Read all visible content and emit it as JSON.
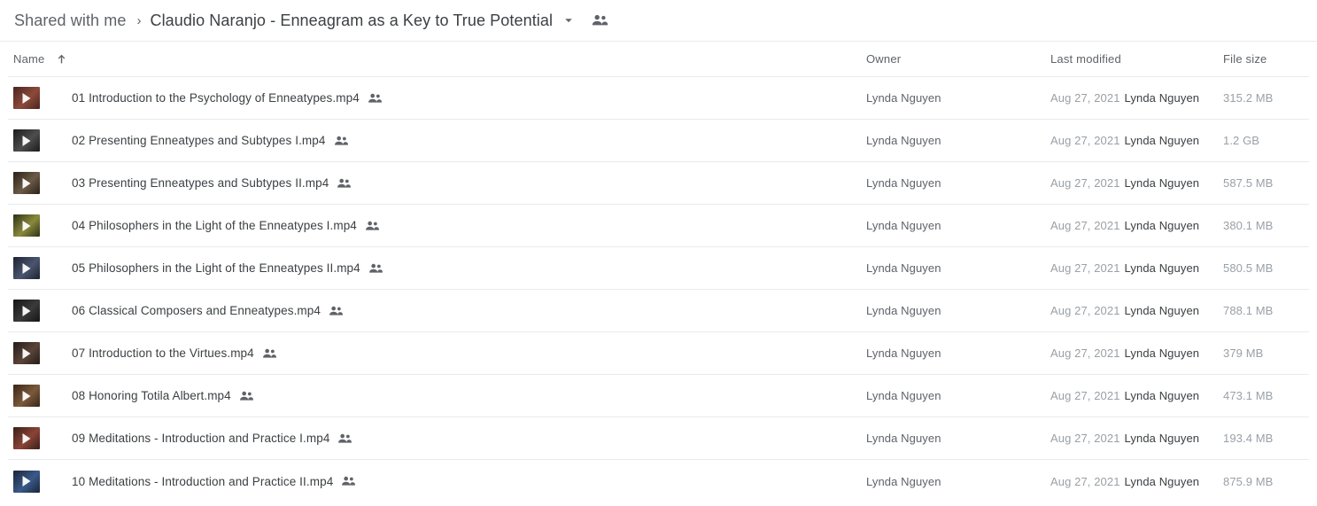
{
  "breadcrumb": {
    "root_label": "Shared with me",
    "separator": "›",
    "current_label": "Claudio Naranjo - Enneagram as a Key to True Potential",
    "caret_icon": "chevron-down-icon",
    "people_icon": "shared-people-icon"
  },
  "columns": {
    "name": "Name",
    "owner": "Owner",
    "last_modified": "Last modified",
    "file_size": "File size",
    "sort_direction": "ascending",
    "sort_icon": "arrow-up-icon"
  },
  "colors": {
    "text_primary": "#3c4043",
    "text_secondary": "#5f6368",
    "text_muted": "#9aa0a6",
    "divider": "#e8eaed",
    "background": "#ffffff"
  },
  "rows": [
    {
      "name": "01 Introduction to the Psychology of Enneatypes.mp4",
      "owner": "Lynda Nguyen",
      "modified_date": "Aug 27, 2021",
      "modified_by": "Lynda Nguyen",
      "size": "315.2 MB",
      "thumb_color_a": "#4a2420",
      "thumb_color_b": "#8c4a3a",
      "shared_icon": "shared-people-icon"
    },
    {
      "name": "02 Presenting Enneatypes and Subtypes I.mp4",
      "owner": "Lynda Nguyen",
      "modified_date": "Aug 27, 2021",
      "modified_by": "Lynda Nguyen",
      "size": "1.2 GB",
      "thumb_color_a": "#1b1b1b",
      "thumb_color_b": "#4d4d4d",
      "shared_icon": "shared-people-icon"
    },
    {
      "name": "03 Presenting Enneatypes and Subtypes II.mp4",
      "owner": "Lynda Nguyen",
      "modified_date": "Aug 27, 2021",
      "modified_by": "Lynda Nguyen",
      "size": "587.5 MB",
      "thumb_color_a": "#2a2018",
      "thumb_color_b": "#6b5a46",
      "shared_icon": "shared-people-icon"
    },
    {
      "name": "04 Philosophers in the Light of the Enneatypes I.mp4",
      "owner": "Lynda Nguyen",
      "modified_date": "Aug 27, 2021",
      "modified_by": "Lynda Nguyen",
      "size": "380.1 MB",
      "thumb_color_a": "#2d3018",
      "thumb_color_b": "#8a8a3c",
      "shared_icon": "shared-people-icon"
    },
    {
      "name": "05 Philosophers in the Light of the Enneatypes II.mp4",
      "owner": "Lynda Nguyen",
      "modified_date": "Aug 27, 2021",
      "modified_by": "Lynda Nguyen",
      "size": "580.5 MB",
      "thumb_color_a": "#1e2230",
      "thumb_color_b": "#4a5570",
      "shared_icon": "shared-people-icon"
    },
    {
      "name": "06 Classical Composers and Enneatypes.mp4",
      "owner": "Lynda Nguyen",
      "modified_date": "Aug 27, 2021",
      "modified_by": "Lynda Nguyen",
      "size": "788.1 MB",
      "thumb_color_a": "#141414",
      "thumb_color_b": "#3a3a3a",
      "shared_icon": "shared-people-icon"
    },
    {
      "name": "07 Introduction to the Virtues.mp4",
      "owner": "Lynda Nguyen",
      "modified_date": "Aug 27, 2021",
      "modified_by": "Lynda Nguyen",
      "size": "379 MB",
      "thumb_color_a": "#241c18",
      "thumb_color_b": "#5a4438",
      "shared_icon": "shared-people-icon"
    },
    {
      "name": "08 Honoring Totila Albert.mp4",
      "owner": "Lynda Nguyen",
      "modified_date": "Aug 27, 2021",
      "modified_by": "Lynda Nguyen",
      "size": "473.1 MB",
      "thumb_color_a": "#3a2418",
      "thumb_color_b": "#7a5a3a",
      "shared_icon": "shared-people-icon"
    },
    {
      "name": "09 Meditations - Introduction and Practice I.mp4",
      "owner": "Lynda Nguyen",
      "modified_date": "Aug 27, 2021",
      "modified_by": "Lynda Nguyen",
      "size": "193.4 MB",
      "thumb_color_a": "#3a1e1a",
      "thumb_color_b": "#8a4436",
      "shared_icon": "shared-people-icon"
    },
    {
      "name": "10 Meditations - Introduction and Practice II.mp4",
      "owner": "Lynda Nguyen",
      "modified_date": "Aug 27, 2021",
      "modified_by": "Lynda Nguyen",
      "size": "875.9 MB",
      "thumb_color_a": "#1a2438",
      "thumb_color_b": "#3a5a8a",
      "shared_icon": "shared-people-icon"
    }
  ]
}
